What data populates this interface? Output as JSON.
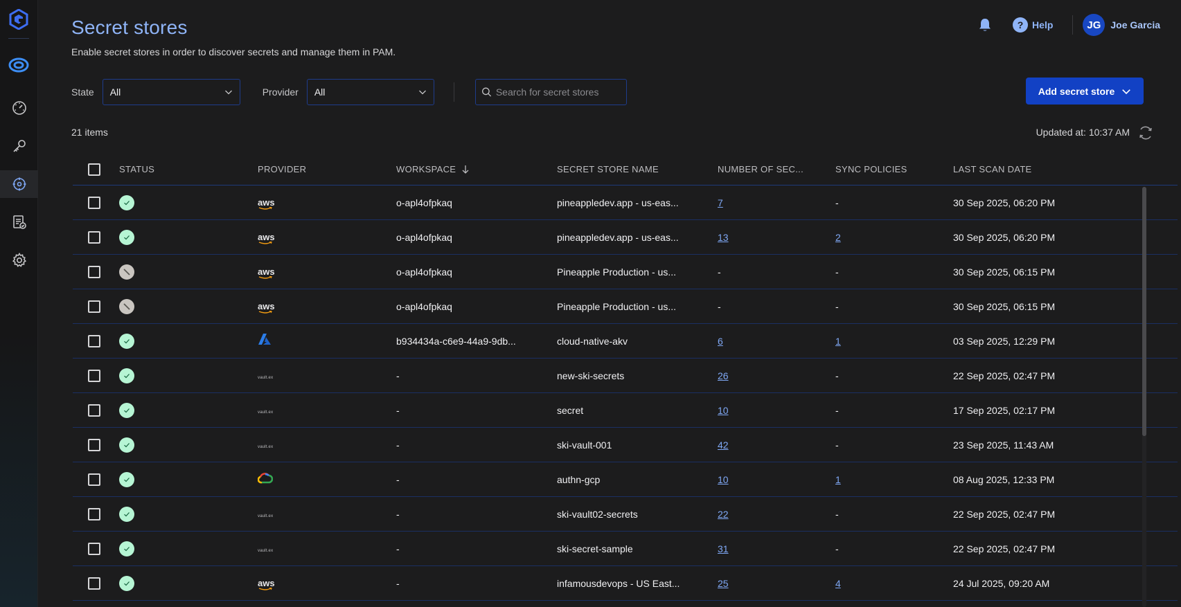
{
  "header": {
    "title": "Secret stores",
    "subtitle": "Enable secret stores in order to discover secrets and manage them in PAM."
  },
  "topbar": {
    "help_label": "Help",
    "user_initials": "JG",
    "user_name": "Joe Garcia"
  },
  "filters": {
    "state_label": "State",
    "state_value": "All",
    "provider_label": "Provider",
    "provider_value": "All",
    "search_placeholder": "Search for secret stores"
  },
  "actions": {
    "add_label": "Add secret store"
  },
  "summary": {
    "items_count": "21 items",
    "updated_at": "Updated at: 10:37 AM"
  },
  "columns": {
    "status": "STATUS",
    "provider": "PROVIDER",
    "workspace": "WORKSPACE",
    "name": "SECRET STORE NAME",
    "secrets": "NUMBER OF SEC...",
    "sync": "SYNC POLICIES",
    "scan": "LAST SCAN DATE"
  },
  "rows": [
    {
      "status": "ok",
      "provider": "aws",
      "workspace": "o-apl4ofpkaq",
      "name": "pineappledev.app - us-eas...",
      "secrets": "7",
      "sync": "-",
      "scan": "30 Sep 2025, 06:20 PM"
    },
    {
      "status": "ok",
      "provider": "aws",
      "workspace": "o-apl4ofpkaq",
      "name": "pineappledev.app - us-eas...",
      "secrets": "13",
      "sync": "2",
      "scan": "30 Sep 2025, 06:20 PM"
    },
    {
      "status": "disabled",
      "provider": "aws",
      "workspace": "o-apl4ofpkaq",
      "name": "Pineapple Production - us...",
      "secrets": "-",
      "sync": "-",
      "scan": "30 Sep 2025, 06:15 PM"
    },
    {
      "status": "disabled",
      "provider": "aws",
      "workspace": "o-apl4ofpkaq",
      "name": "Pineapple Production - us...",
      "secrets": "-",
      "sync": "-",
      "scan": "30 Sep 2025, 06:15 PM"
    },
    {
      "status": "ok",
      "provider": "azure",
      "workspace": "b934434a-c6e9-44a9-9db...",
      "name": "cloud-native-akv",
      "secrets": "6",
      "sync": "1",
      "scan": "03 Sep 2025, 12:29 PM"
    },
    {
      "status": "ok",
      "provider": "vault",
      "workspace": "-",
      "name": "new-ski-secrets",
      "secrets": "26",
      "sync": "-",
      "scan": "22 Sep 2025, 02:47 PM"
    },
    {
      "status": "ok",
      "provider": "vault",
      "workspace": "-",
      "name": "secret",
      "secrets": "10",
      "sync": "-",
      "scan": "17 Sep 2025, 02:17 PM"
    },
    {
      "status": "ok",
      "provider": "vault",
      "workspace": "-",
      "name": "ski-vault-001",
      "secrets": "42",
      "sync": "-",
      "scan": "23 Sep 2025, 11:43 AM"
    },
    {
      "status": "ok",
      "provider": "gcp",
      "workspace": "-",
      "name": "authn-gcp",
      "secrets": "10",
      "sync": "1",
      "scan": "08 Aug 2025, 12:33 PM"
    },
    {
      "status": "ok",
      "provider": "vault",
      "workspace": "-",
      "name": "ski-vault02-secrets",
      "secrets": "22",
      "sync": "-",
      "scan": "22 Sep 2025, 02:47 PM"
    },
    {
      "status": "ok",
      "provider": "vault",
      "workspace": "-",
      "name": "ski-secret-sample",
      "secrets": "31",
      "sync": "-",
      "scan": "22 Sep 2025, 02:47 PM"
    },
    {
      "status": "ok",
      "provider": "aws",
      "workspace": "-",
      "name": "infamousdevops - US East...",
      "secrets": "25",
      "sync": "4",
      "scan": "24 Jul 2025, 09:20 AM"
    }
  ],
  "provider_text": {
    "aws": "aws",
    "vault": "vault.ex"
  },
  "icons": {
    "sidebar": [
      "logo-icon",
      "app-switcher-icon",
      "dashboard-icon",
      "key-icon",
      "discovery-icon",
      "policy-icon",
      "settings-icon"
    ],
    "topbar": [
      "bell-icon",
      "help-icon"
    ]
  },
  "colors": {
    "accent": "#1241c4",
    "link": "#7fa8f5",
    "title": "#8fb4f7",
    "status_ok": "#b6f5d4",
    "status_disabled": "#c9c5c0"
  }
}
